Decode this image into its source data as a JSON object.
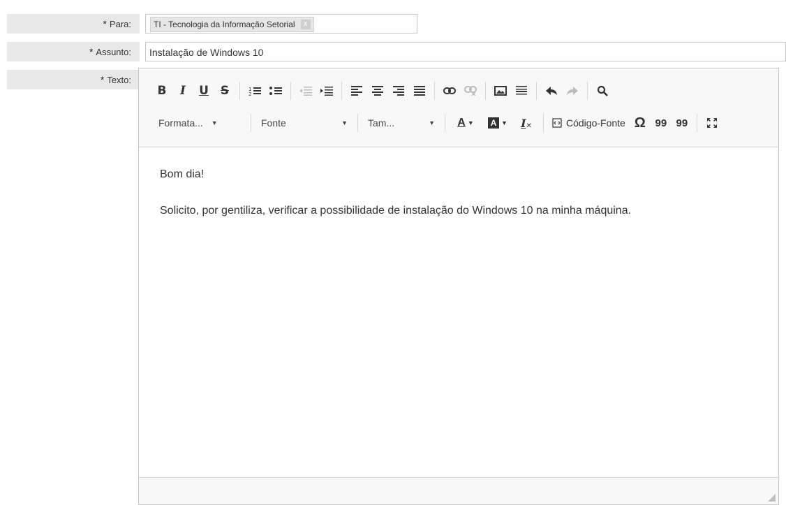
{
  "form": {
    "to": {
      "label": "Para:",
      "tag": "TI - Tecnologia da Informação Setorial",
      "remove": "x"
    },
    "subject": {
      "label": "Assunto:",
      "value": "Instalação de Windows 10"
    },
    "text": {
      "label": "Texto:"
    },
    "required_mark": "*"
  },
  "toolbar": {
    "row1": [
      "bold",
      "italic",
      "underline",
      "strikethrough",
      "numbered-list",
      "bulleted-list",
      "outdent",
      "indent",
      "align-left",
      "align-center",
      "align-right",
      "justify",
      "link",
      "unlink",
      "image",
      "horizontal-line",
      "undo",
      "redo",
      "find"
    ],
    "bold": "B",
    "italic": "I",
    "underline": "U",
    "strike": "S",
    "format_label": "Formata...",
    "font_label": "Fonte",
    "size_label": "Tam...",
    "text_color": "A",
    "bg_color": "A",
    "remove_format": "I",
    "source_label": "Código-Fonte",
    "special_char": "Ω",
    "quote_open": "99",
    "quote_remove": "99"
  },
  "content": {
    "line1": "Bom dia!",
    "line2": "Solicito, por gentiliza, verificar a possibilidade de instalação do Windows 10 na minha máquina."
  }
}
